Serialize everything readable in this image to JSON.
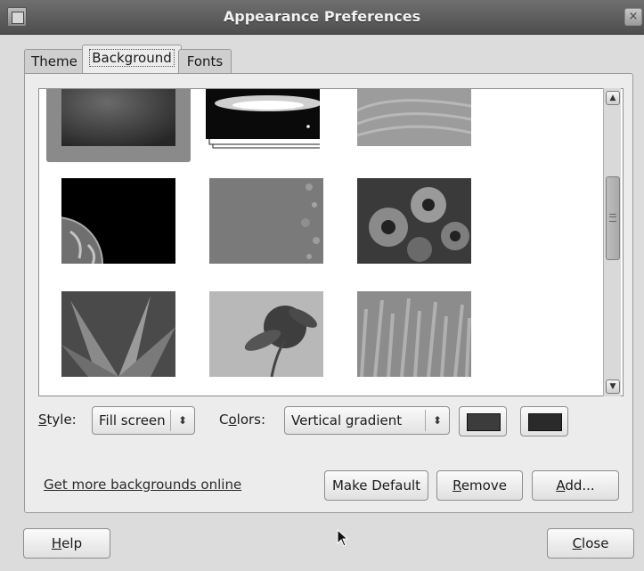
{
  "window": {
    "title": "Appearance Preferences",
    "close_glyph": "×"
  },
  "tabs": [
    {
      "label": "Theme"
    },
    {
      "label": "Background"
    },
    {
      "label": "Fonts"
    }
  ],
  "backgrounds": [
    {
      "name": "dark-metal",
      "selected": true
    },
    {
      "name": "galaxy-stack",
      "selected": false
    },
    {
      "name": "grass-blades",
      "selected": false
    },
    {
      "name": "earth-space",
      "selected": false
    },
    {
      "name": "bubbles-gray",
      "selected": false
    },
    {
      "name": "flowers-daisies",
      "selected": false
    },
    {
      "name": "flower-petals",
      "selected": false
    },
    {
      "name": "flower-blur",
      "selected": false
    },
    {
      "name": "tall-grass",
      "selected": false
    }
  ],
  "scrollbar": {
    "up_icon": "chevron-up",
    "down_icon": "chevron-down"
  },
  "style": {
    "label_u": "S",
    "label_rest": "tyle:",
    "value": "Fill screen",
    "arrow": "⬍"
  },
  "colors": {
    "label_pre": "C",
    "label_u": "o",
    "label_rest": "lors:",
    "value": "Vertical gradient",
    "arrow": "⬍",
    "primary": "#3c3c3c",
    "secondary": "#2a2a2a"
  },
  "actions": {
    "get_more": "Get more backgrounds online",
    "make_default": "Make Default",
    "remove_u": "R",
    "remove_rest": "emove",
    "add_u": "A",
    "add_rest": "dd..."
  },
  "footer": {
    "help_u": "H",
    "help_rest": "elp",
    "close_u": "C",
    "close_rest": "lose"
  }
}
